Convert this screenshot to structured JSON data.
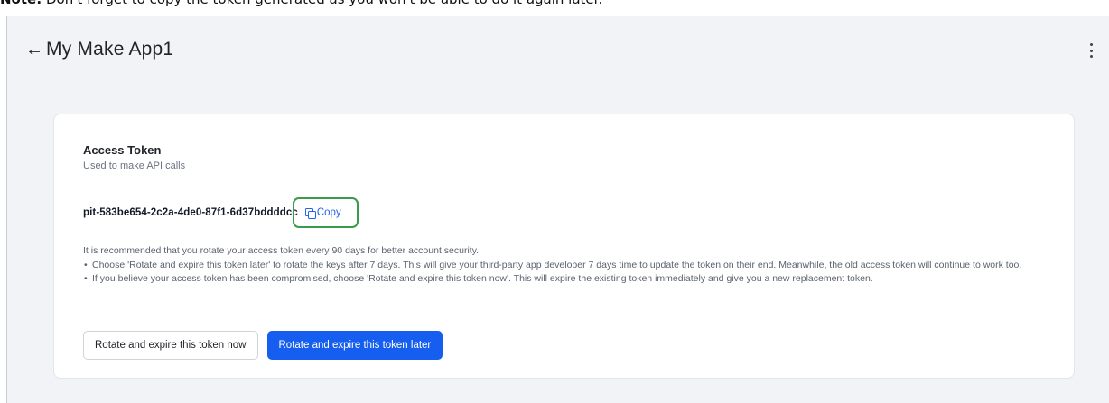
{
  "note": {
    "prefix": "Note:",
    "text": " Don't forget to copy the token generated as you won't be able to do it again later."
  },
  "header": {
    "back_icon": "←",
    "title": "My Make App1",
    "menu_icon": "kebab-menu-icon"
  },
  "access_token": {
    "title": "Access Token",
    "subtitle": "Used to make API calls",
    "token_value": "pit-583be654-2c2a-4de0-87f1-6d37bddddcc",
    "copy_label": "Copy",
    "copy_icon": "copy-icon"
  },
  "info": {
    "intro": "It is recommended that you rotate your access token every 90 days for better account security.",
    "bullets": [
      "Choose 'Rotate and expire this token later' to rotate the keys after 7 days. This will give your third-party app developer 7 days time to update the token on their end. Meanwhile, the old access token will continue to work too.",
      "If you believe your access token has been compromised, choose 'Rotate and expire this token now'. This will expire the existing token immediately and give you a new replacement token."
    ]
  },
  "actions": {
    "rotate_now_label": "Rotate and expire this token now",
    "rotate_later_label": "Rotate and expire this token later"
  },
  "colors": {
    "primary": "#155eef",
    "link": "#2563eb",
    "highlight": "#3a9b4a",
    "background": "#f1f3f6"
  }
}
